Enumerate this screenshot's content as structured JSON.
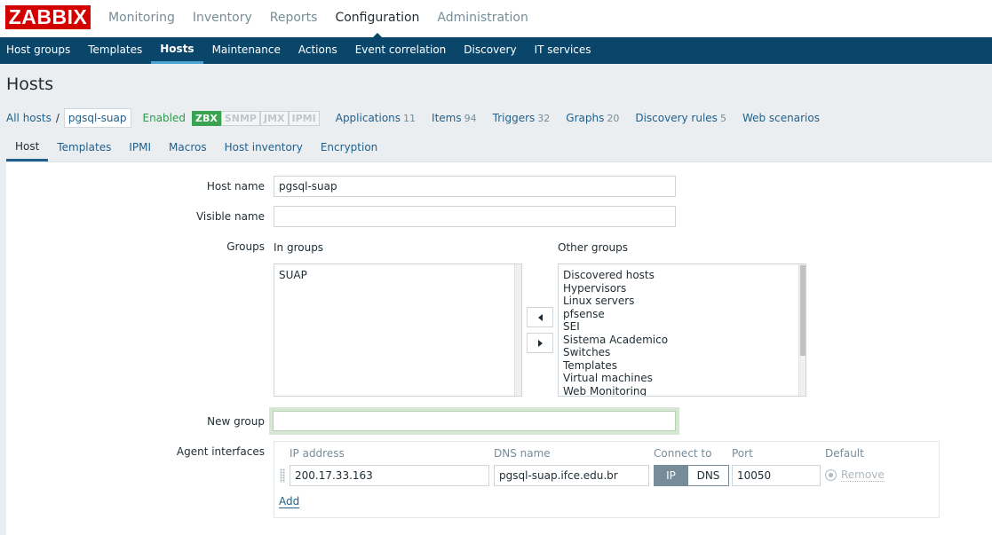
{
  "logo": "ZABBIX",
  "main_menu": [
    "Monitoring",
    "Inventory",
    "Reports",
    "Configuration",
    "Administration"
  ],
  "sub_menu": [
    "Host groups",
    "Templates",
    "Hosts",
    "Maintenance",
    "Actions",
    "Event correlation",
    "Discovery",
    "IT services"
  ],
  "page_title": "Hosts",
  "breadcrumbs": {
    "all_hosts": "All hosts",
    "separator": "/",
    "current": "pgsql-suap",
    "status": "Enabled",
    "availability": [
      "ZBX",
      "SNMP",
      "JMX",
      "IPMI"
    ],
    "items": [
      {
        "label": "Applications",
        "count": "11"
      },
      {
        "label": "Items",
        "count": "94"
      },
      {
        "label": "Triggers",
        "count": "32"
      },
      {
        "label": "Graphs",
        "count": "20"
      },
      {
        "label": "Discovery rules",
        "count": "5"
      },
      {
        "label": "Web scenarios",
        "count": ""
      }
    ]
  },
  "form_tabs": [
    "Host",
    "Templates",
    "IPMI",
    "Macros",
    "Host inventory",
    "Encryption"
  ],
  "form": {
    "host_name_label": "Host name",
    "host_name_value": "pgsql-suap",
    "visible_name_label": "Visible name",
    "visible_name_value": "",
    "groups_label": "Groups",
    "in_groups_label": "In groups",
    "in_groups": [
      "SUAP"
    ],
    "other_groups_label": "Other groups",
    "other_groups": [
      "Discovered hosts",
      "Hypervisors",
      "Linux servers",
      "pfsense",
      "SEI",
      "Sistema Academico",
      "Switches",
      "Templates",
      "Virtual machines",
      "Web Monitoring"
    ],
    "new_group_label": "New group",
    "new_group_value": "",
    "agent_interfaces_label": "Agent interfaces",
    "agent": {
      "ip_header": "IP address",
      "dns_header": "DNS name",
      "connect_header": "Connect to",
      "port_header": "Port",
      "default_header": "Default",
      "ip": "200.17.33.163",
      "dns": "pgsql-suap.ifce.edu.br",
      "connect_ip": "IP",
      "connect_dns": "DNS",
      "port": "10050",
      "remove": "Remove",
      "add": "Add"
    }
  }
}
